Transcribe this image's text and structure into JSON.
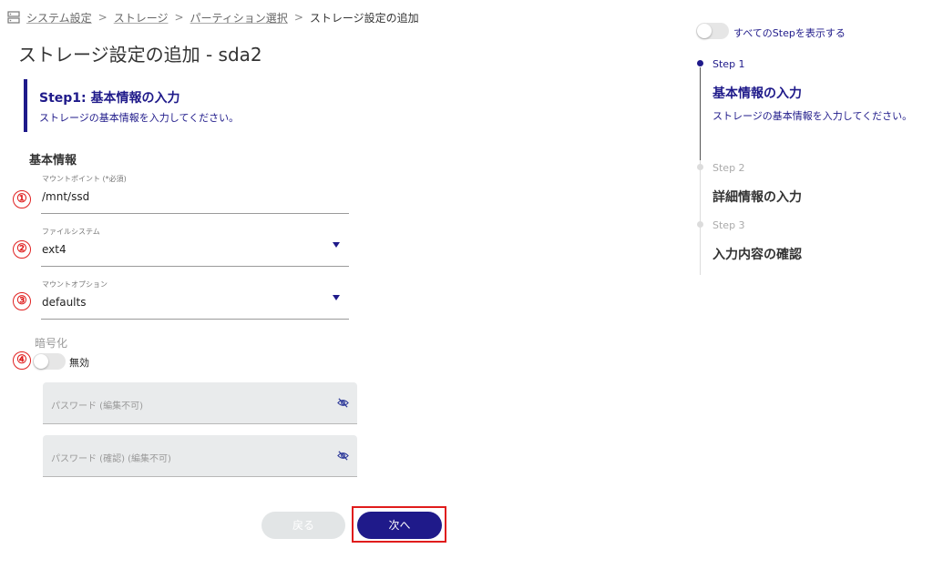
{
  "breadcrumb": {
    "items": [
      "システム設定",
      "ストレージ",
      "パーティション選択"
    ],
    "current": "ストレージ設定の追加",
    "separator": ">"
  },
  "page": {
    "title": "ストレージ設定の追加 - sda2"
  },
  "step_header": {
    "title": "Step1: 基本情報の入力",
    "description": "ストレージの基本情報を入力してください。"
  },
  "section": {
    "title": "基本情報"
  },
  "markers": [
    "①",
    "②",
    "③",
    "④"
  ],
  "fields": {
    "mount_point": {
      "label": "マウントポイント (*必須)",
      "value": "/mnt/ssd"
    },
    "filesystem": {
      "label": "ファイルシステム",
      "value": "ext4"
    },
    "mount_option": {
      "label": "マウントオプション",
      "value": "defaults"
    }
  },
  "encryption": {
    "label": "暗号化",
    "toggle_text": "無効",
    "enabled": false,
    "password_placeholder": "パスワード (編集不可)",
    "password_confirm_placeholder": "パスワード (確認) (編集不可)"
  },
  "buttons": {
    "back": "戻る",
    "next": "次へ"
  },
  "stepper": {
    "show_all_label": "すべてのStepを表示する",
    "show_all_enabled": false,
    "steps": [
      {
        "label": "Step 1",
        "title": "基本情報の入力",
        "description": "ストレージの基本情報を入力してください。",
        "active": true
      },
      {
        "label": "Step 2",
        "title": "詳細情報の入力",
        "active": false
      },
      {
        "label": "Step 3",
        "title": "入力内容の確認",
        "active": false
      }
    ]
  },
  "colors": {
    "primary": "#1f1a8a",
    "annotation_red": "#e01c1c",
    "disabled_button": "#e2e5e6",
    "input_disabled_bg": "#e9ebec"
  },
  "icons": {
    "breadcrumb": "storage-icon",
    "password_visibility": "eye-off-icon",
    "dropdown": "triangle-down-icon"
  }
}
